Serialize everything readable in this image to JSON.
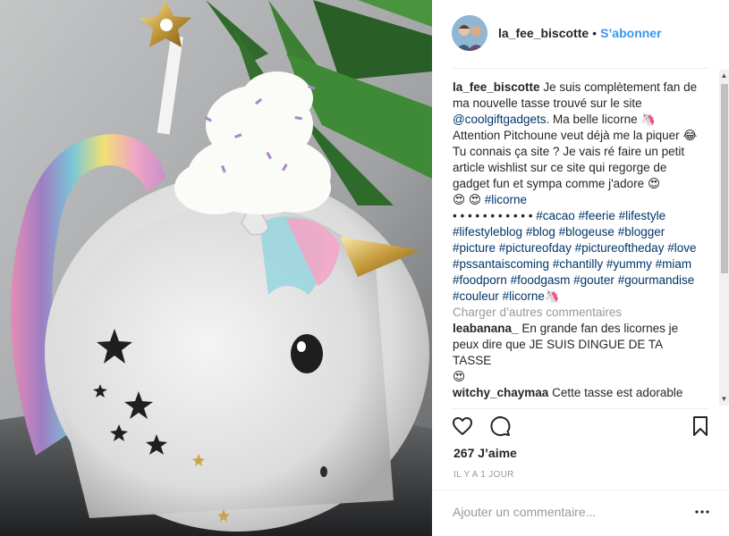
{
  "post": {
    "username": "la_fee_biscotte",
    "follow_separator": "•",
    "follow_label": "S’abonner",
    "caption": {
      "author": "la_fee_biscotte",
      "text1": "Je suis complètement fan de ma nouvelle tasse trouvé sur le site",
      "mention": "@coolgiftgadgets",
      "text2": ". Ma belle licorne",
      "text3": "Attention Pitchoune veut déjà me la piquer",
      "text4": "Tu connais ça site ? Je vais ré faire un petit article wishlist sur ce site qui regorge de gadget fun et sympa comme j'adore",
      "tag_licorne": "#licorne",
      "dot_line": "• • • • • • • • • • •",
      "hashtags": [
        "#cacao",
        "#feerie",
        "#lifestyle",
        "#lifestyleblog",
        "#blog",
        "#blogeuse",
        "#blogger",
        "#picture",
        "#pictureofday",
        "#pictureoftheday",
        "#love",
        "#pssantaiscoming",
        "#chantilly",
        "#yummy",
        "#miam",
        "#foodporn",
        "#foodgasm",
        "#gouter",
        "#gourmandise",
        "#couleur",
        "#licorne"
      ]
    },
    "load_more": "Charger d’autres commentaires",
    "comments": [
      {
        "user": "leabanana_",
        "text": "En grande fan des licornes je peux dire que JE SUIS DINGUE DE TA TASSE"
      },
      {
        "user": "witchy_chaymaa",
        "text": "Cette tasse est adorable"
      }
    ],
    "likes": "267 J’aime",
    "time": "IL Y A 1 JOUR",
    "add_comment_placeholder": "Ajouter un commentaire..."
  },
  "icons": {
    "heart": "heart-icon",
    "comment": "comment-icon",
    "save": "bookmark-icon",
    "options": "more-options-icon"
  },
  "colors": {
    "link": "#003569",
    "follow": "#3897f0",
    "muted": "#999999"
  }
}
